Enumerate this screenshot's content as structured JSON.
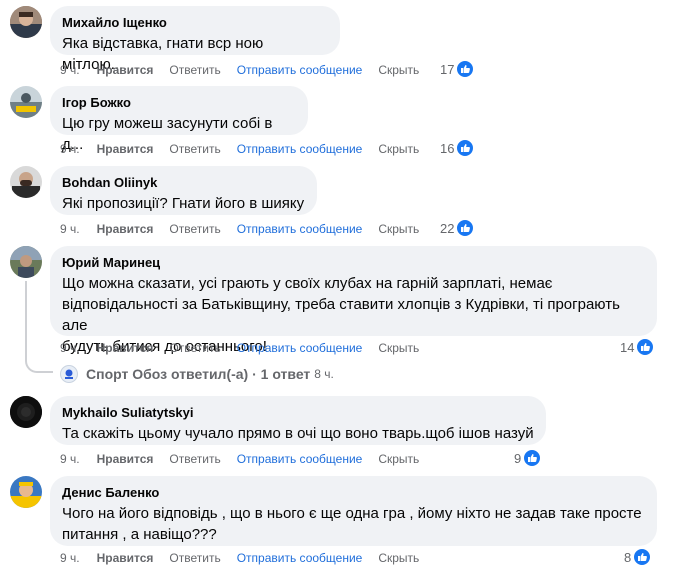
{
  "actions": {
    "like": "Нравится",
    "reply": "Ответить",
    "message": "Отправить сообщение",
    "hide": "Скрыть"
  },
  "comments": [
    {
      "author": "Михайло Іщенко",
      "text": "Яка відставка, гнати вср  ною мітлою...",
      "time": "9 ч.",
      "likes": "17"
    },
    {
      "author": "Ігор Божко",
      "text": "Цю гру можеш засунути собі в д...",
      "time": "9 ч.",
      "likes": "16"
    },
    {
      "author": "Bohdan Oliinyk",
      "text": "Які пропозиції? Гнати його в шияку",
      "time": "9 ч.",
      "likes": "22"
    },
    {
      "author": "Юрий Маринец",
      "text_lines": [
        "Що можна сказати, усі грають у своїх клубах на гарній зарплаті, немає",
        "відповідальності за Батьківщину, треба ставити хлопців з Кудрівки, ті програють але",
        "будуть битися до останнього!"
      ],
      "time": "9 ч.",
      "likes": "14"
    },
    {
      "author": "Mykhailo Suliatytskyi",
      "text": "Та скажіть цьому чучало прямо в очі що воно тварь.щоб ішов назуй",
      "time": "9 ч.",
      "likes": "9"
    },
    {
      "author": "Денис Баленко",
      "text_lines": [
        "Чого на його відповідь , що в нього є ще одна гра , йому ніхто не задав таке просте",
        "питання , а навіщо???"
      ],
      "time": "9 ч.",
      "likes": "8"
    }
  ],
  "replies_summary": {
    "page_name": "Спорт Обоз",
    "replied_text": "ответил(-а)",
    "separator": "·",
    "count_text": "1 ответ",
    "time": "8 ч."
  },
  "colors": {
    "bubble": "#f0f2f5",
    "link": "#216fdb",
    "muted": "#65676b",
    "like_badge": "#1877f2"
  }
}
